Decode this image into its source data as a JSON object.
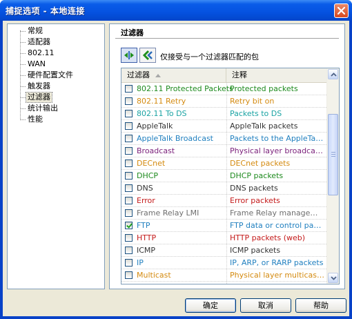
{
  "window": {
    "title": "捕捉选项 - 本地连接"
  },
  "tree": {
    "items": [
      {
        "label": "常规"
      },
      {
        "label": "适配器"
      },
      {
        "label": "802.11"
      },
      {
        "label": "WAN"
      },
      {
        "label": "硬件配置文件"
      },
      {
        "label": "触发器"
      },
      {
        "label": "过滤器",
        "selected": true
      },
      {
        "label": "统计输出"
      },
      {
        "label": "性能"
      }
    ]
  },
  "panel": {
    "section_title": "过滤器",
    "mode_label": "仅接受与一个过滤器匹配的包",
    "toolbar": [
      {
        "icon": "accept-filter-icon",
        "pressed": true
      },
      {
        "icon": "reject-filter-icon",
        "pressed": false
      }
    ],
    "columns": {
      "filter": "过滤器",
      "note": "注释"
    },
    "rows": [
      {
        "name": "802.11 Protected Packets",
        "note": "Protected packets",
        "checked": false,
        "color": "#1d8a1d"
      },
      {
        "name": "802.11 Retry",
        "note": "Retry bit on",
        "checked": false,
        "color": "#d48a0f"
      },
      {
        "name": "802.11 To DS",
        "note": "Packets to DS",
        "checked": false,
        "color": "#1aa3a3"
      },
      {
        "name": "AppleTalk",
        "note": "AppleTalk packets",
        "checked": false,
        "color": "#333333"
      },
      {
        "name": "AppleTalk Broadcast",
        "note": "Packets to the AppleTalk broadcast address",
        "checked": false,
        "color": "#1f7fbf"
      },
      {
        "name": "Broadcast",
        "note": "Physical layer broadcasts",
        "checked": false,
        "color": "#7a1f7a"
      },
      {
        "name": "DECnet",
        "note": "DECnet packets",
        "checked": false,
        "color": "#d48a0f"
      },
      {
        "name": "DHCP",
        "note": "DHCP packets",
        "checked": false,
        "color": "#1d8a1d"
      },
      {
        "name": "DNS",
        "note": "DNS packets",
        "checked": false,
        "color": "#333333"
      },
      {
        "name": "Error",
        "note": "Error packets",
        "checked": false,
        "color": "#c41a1a"
      },
      {
        "name": "Frame Relay LMI",
        "note": "Frame Relay management interface packets",
        "checked": false,
        "color": "#6e6e6e"
      },
      {
        "name": "FTP",
        "note": "FTP data or control packets",
        "checked": true,
        "color": "#1f7fbf"
      },
      {
        "name": "HTTP",
        "note": "HTTP packets (web)",
        "checked": false,
        "color": "#c41a1a"
      },
      {
        "name": "ICMP",
        "note": "ICMP packets",
        "checked": false,
        "color": "#333333"
      },
      {
        "name": "IP",
        "note": "IP, ARP, or RARP packets",
        "checked": false,
        "color": "#1f7fbf"
      },
      {
        "name": "Multicast",
        "note": "Physical layer multicast e...",
        "checked": false,
        "color": "#d48a0f"
      }
    ]
  },
  "buttons": {
    "ok": "确定",
    "cancel": "取消",
    "help": "帮助"
  }
}
